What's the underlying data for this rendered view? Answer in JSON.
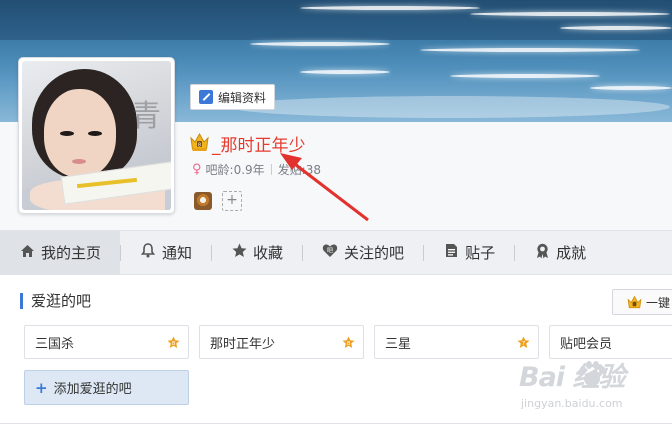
{
  "header": {
    "edit_profile_label": "编辑资料"
  },
  "profile": {
    "username": "_那时正年少",
    "age_label": "吧龄:0.9年",
    "posts_label": "发贴:38",
    "avatar_brush_char": "青"
  },
  "nav": {
    "items": [
      {
        "label": "我的主页",
        "icon": "home-icon"
      },
      {
        "label": "通知",
        "icon": "bell-icon"
      },
      {
        "label": "收藏",
        "icon": "star-icon"
      },
      {
        "label": "关注的吧",
        "icon": "heart-bar-icon"
      },
      {
        "label": "贴子",
        "icon": "document-icon"
      },
      {
        "label": "成就",
        "icon": "award-icon"
      }
    ]
  },
  "favorites": {
    "title": "爱逛的吧",
    "one_key_label": "一键",
    "bars": [
      {
        "name": "三国杀",
        "level": "8",
        "level_color": "#f0a020"
      },
      {
        "name": "那时正年少",
        "level": "8",
        "level_color": "#f0a020"
      },
      {
        "name": "三星",
        "level": "7",
        "level_color": "#f0a020"
      },
      {
        "name": "贴吧会员",
        "level": "",
        "level_color": ""
      }
    ],
    "add_label": "添加爱逛的吧"
  },
  "watermark": {
    "brand": "Bai 经验",
    "sub": "jingyan.baidu.com"
  },
  "colors": {
    "accent": "#3b78d8",
    "username": "#e53b2f",
    "arrow": "#e2322d"
  }
}
